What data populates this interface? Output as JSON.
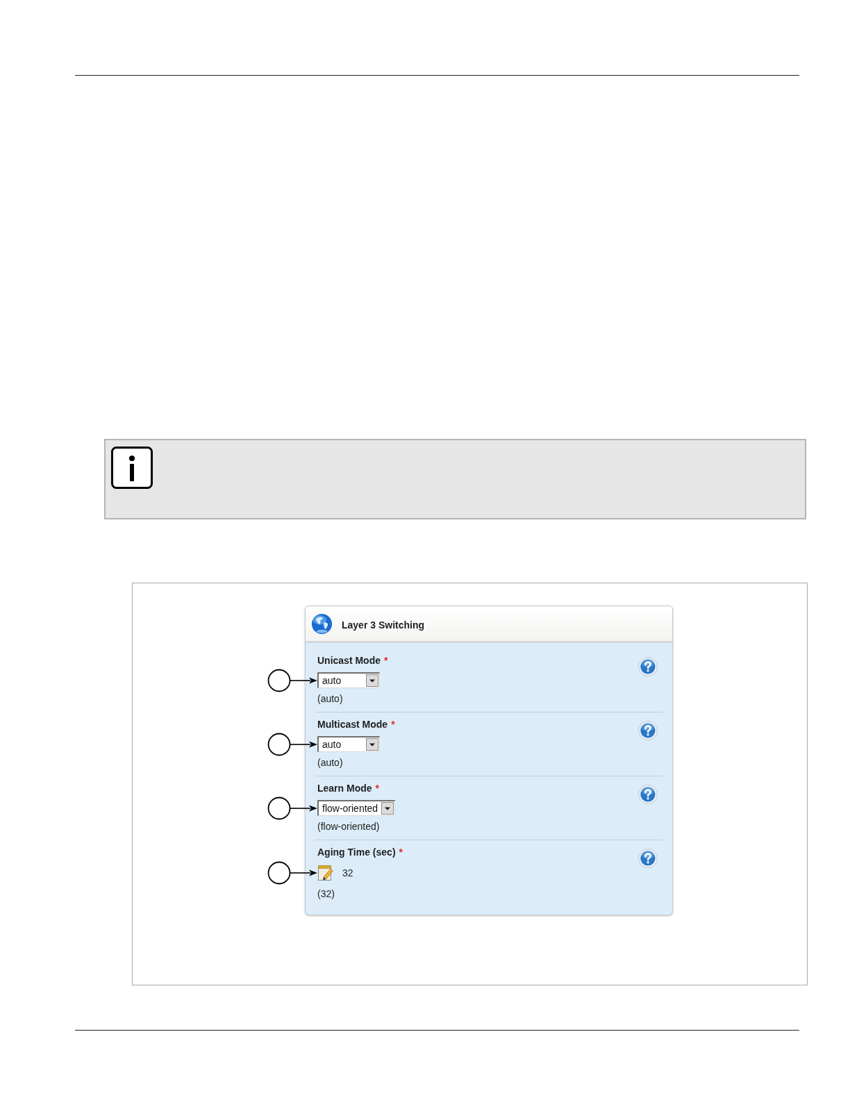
{
  "note": {
    "kind": "info"
  },
  "panel": {
    "title": "Layer 3 Switching",
    "fields": [
      {
        "kind": "select",
        "label": "Unicast Mode",
        "required_mark": "*",
        "value": "auto",
        "default": "(auto)",
        "callout": true
      },
      {
        "kind": "select",
        "label": "Multicast Mode",
        "required_mark": "*",
        "value": "auto",
        "default": "(auto)",
        "callout": true
      },
      {
        "kind": "select",
        "label": "Learn Mode",
        "required_mark": "*",
        "value": "flow-oriented",
        "default": "(flow-oriented)",
        "callout": true
      },
      {
        "kind": "editable",
        "label": "Aging Time (sec)",
        "required_mark": "*",
        "value": "32",
        "default": "(32)",
        "callout": true
      }
    ]
  }
}
